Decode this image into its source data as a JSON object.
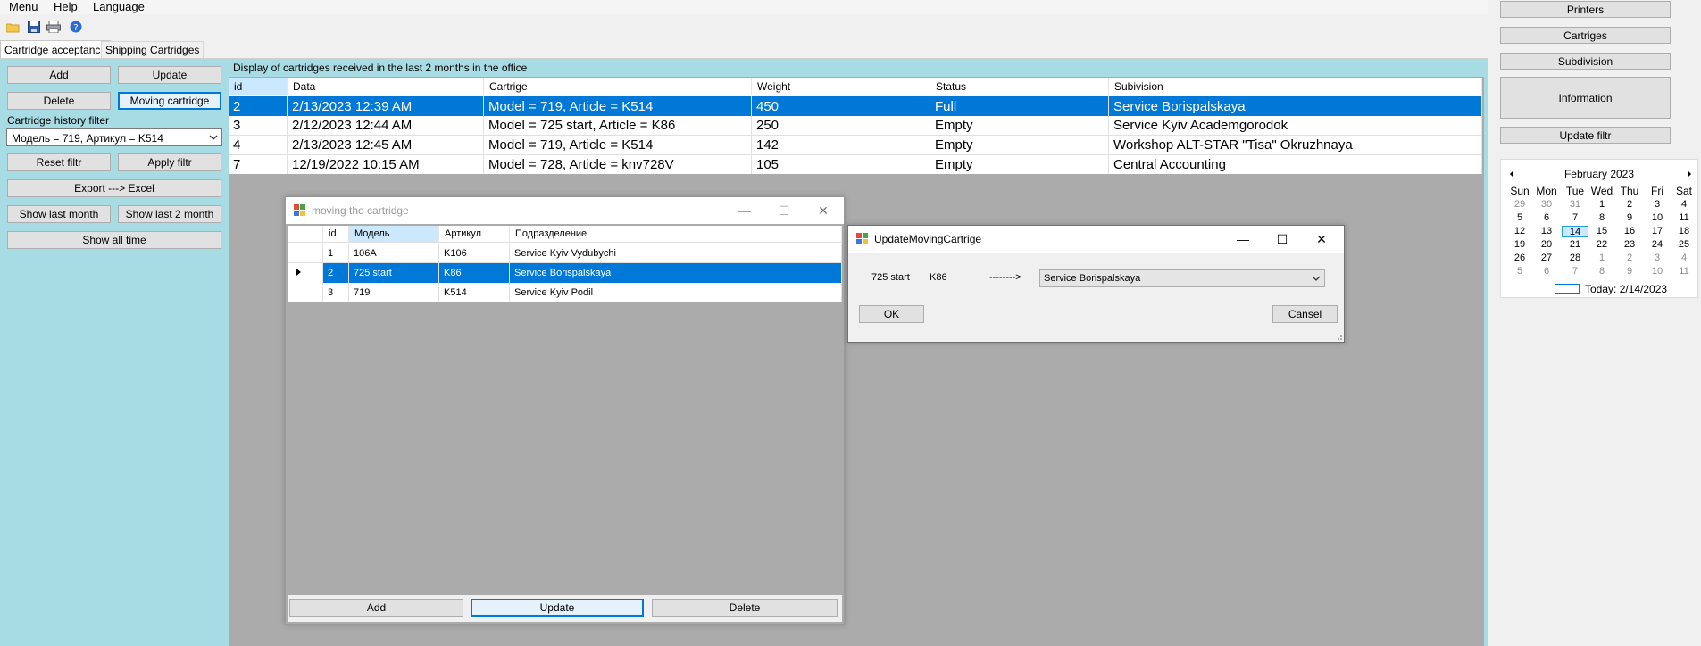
{
  "menu": {
    "items": [
      "Menu",
      "Help",
      "Language"
    ]
  },
  "tabs": [
    "Cartridge acceptance",
    "Shipping Cartridges"
  ],
  "left": {
    "add": "Add",
    "update": "Update",
    "delete": "Delete",
    "moving": "Moving cartridge",
    "filter_label": "Cartridge history filter",
    "filter_value": "Модель = 719, Артикул = K514",
    "reset": "Reset filtr",
    "apply": "Apply filtr",
    "export": "Export ---> Excel",
    "last_month": "Show last month",
    "last_2_month": "Show last 2 month",
    "all_time": "Show all time"
  },
  "main": {
    "caption": "Display of cartridges received in the last 2 months in the office",
    "columns": [
      "id",
      "Data",
      "Cartrige",
      "Weight",
      "Status",
      "Subivision"
    ],
    "rows": [
      [
        "2",
        "2/13/2023 12:39 AM",
        "Model = 719, Article = K514",
        "450",
        "Full",
        "Service Borispalskaya"
      ],
      [
        "3",
        "2/12/2023 12:44 AM",
        "Model = 725 start, Article = K86",
        "250",
        "Empty",
        "Service Kyiv Academgorodok"
      ],
      [
        "4",
        "2/13/2023 12:45 AM",
        "Model = 719, Article = K514",
        "142",
        "Empty",
        "Workshop ALT-STAR \"Tisa\" Okruzhnaya"
      ],
      [
        "7",
        "12/19/2022 10:15 AM",
        "Model = 728, Article = knv728V",
        "105",
        "Empty",
        "Central Accounting"
      ]
    ]
  },
  "moving": {
    "title": "moving the cartridge",
    "columns": [
      "id",
      "Модель",
      "Артикул",
      "Подразделение"
    ],
    "rows": [
      [
        "1",
        "106A",
        "K106",
        "Service Kyiv Vydubychi"
      ],
      [
        "2",
        "725 start",
        "K86",
        "Service Borispalskaya"
      ],
      [
        "3",
        "719",
        "K514",
        "Service Kyiv Podil"
      ]
    ],
    "add": "Add",
    "update": "Update",
    "delete": "Delete"
  },
  "update_dialog": {
    "title": "UpdateMovingCartrige",
    "model": "725 start",
    "article": "K86",
    "arrow": "-------->",
    "target": "Service Borispalskaya",
    "ok": "OK",
    "cancel": "Cansel"
  },
  "right": {
    "printers": "Printers",
    "cartriges": "Cartriges",
    "subdivision": "Subdivision",
    "information": "Information",
    "update_filtr": "Update filtr"
  },
  "calendar": {
    "month": "February 2023",
    "days": [
      "Sun",
      "Mon",
      "Tue",
      "Wed",
      "Thu",
      "Fri",
      "Sat"
    ],
    "weeks": [
      [
        "29",
        "30",
        "31",
        "1",
        "2",
        "3",
        "4"
      ],
      [
        "5",
        "6",
        "7",
        "8",
        "9",
        "10",
        "11"
      ],
      [
        "12",
        "13",
        "14",
        "15",
        "16",
        "17",
        "18"
      ],
      [
        "19",
        "20",
        "21",
        "22",
        "23",
        "24",
        "25"
      ],
      [
        "26",
        "27",
        "28",
        "1",
        "2",
        "3",
        "4"
      ],
      [
        "5",
        "6",
        "7",
        "8",
        "9",
        "10",
        "11"
      ]
    ],
    "today": "Today: 2/14/2023"
  },
  "colors": {
    "selection": "#0078d7",
    "panel": "#a8dce4",
    "workspace": "#ababab"
  },
  "icons": [
    "open-folder-icon",
    "save-disk-icon",
    "printer-icon",
    "help-icon",
    "window-app-icon"
  ]
}
